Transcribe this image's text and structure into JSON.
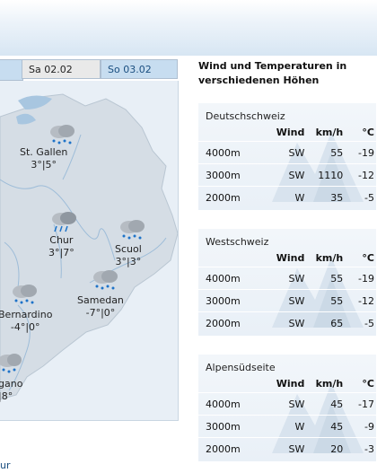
{
  "tabs": [
    {
      "label": "Sa 02.02",
      "active": false
    },
    {
      "label": "So 03.02",
      "active": true
    }
  ],
  "map": {
    "cities": [
      {
        "name": "St. Gallen",
        "temp": "3°|5°"
      },
      {
        "name": "Chur",
        "temp": "3°|7°"
      },
      {
        "name": "Scuol",
        "temp": "3°|3°"
      },
      {
        "name": "Samedan",
        "temp": "-7°|0°"
      },
      {
        "name": "Bernardino",
        "temp": "-4°|0°"
      },
      {
        "name": "gano",
        "temp": "|8°"
      }
    ]
  },
  "bottom_link": "ur",
  "wind_section": {
    "heading": "Wind und Temperaturen in verschiedenen Höhen",
    "columns": {
      "wind": "Wind",
      "kmh": "km/h",
      "celsius": "°C"
    },
    "regions": [
      {
        "name": "Deutschschweiz",
        "rows": [
          {
            "altitude": "4000m",
            "direction": "SW",
            "speed": "55",
            "temp": "-19"
          },
          {
            "altitude": "3000m",
            "direction": "SW",
            "speed": "1110",
            "temp": "-12"
          },
          {
            "altitude": "2000m",
            "direction": "W",
            "speed": "35",
            "temp": "-5"
          }
        ]
      },
      {
        "name": "Westschweiz",
        "rows": [
          {
            "altitude": "4000m",
            "direction": "SW",
            "speed": "55",
            "temp": "-19"
          },
          {
            "altitude": "3000m",
            "direction": "SW",
            "speed": "55",
            "temp": "-12"
          },
          {
            "altitude": "2000m",
            "direction": "SW",
            "speed": "65",
            "temp": "-5"
          }
        ]
      },
      {
        "name": "Alpensüdseite",
        "rows": [
          {
            "altitude": "4000m",
            "direction": "SW",
            "speed": "45",
            "temp": "-17"
          },
          {
            "altitude": "3000m",
            "direction": "W",
            "speed": "45",
            "temp": "-9"
          },
          {
            "altitude": "2000m",
            "direction": "SW",
            "speed": "20",
            "temp": "-3"
          }
        ]
      }
    ]
  },
  "colors": {
    "tab_active_bg": "#c7ddf0",
    "tab_inactive_bg": "#e9e9e9",
    "map_land": "#d5dde5",
    "map_water": "#a8c6e0",
    "box_bg": "#eef3f8"
  }
}
